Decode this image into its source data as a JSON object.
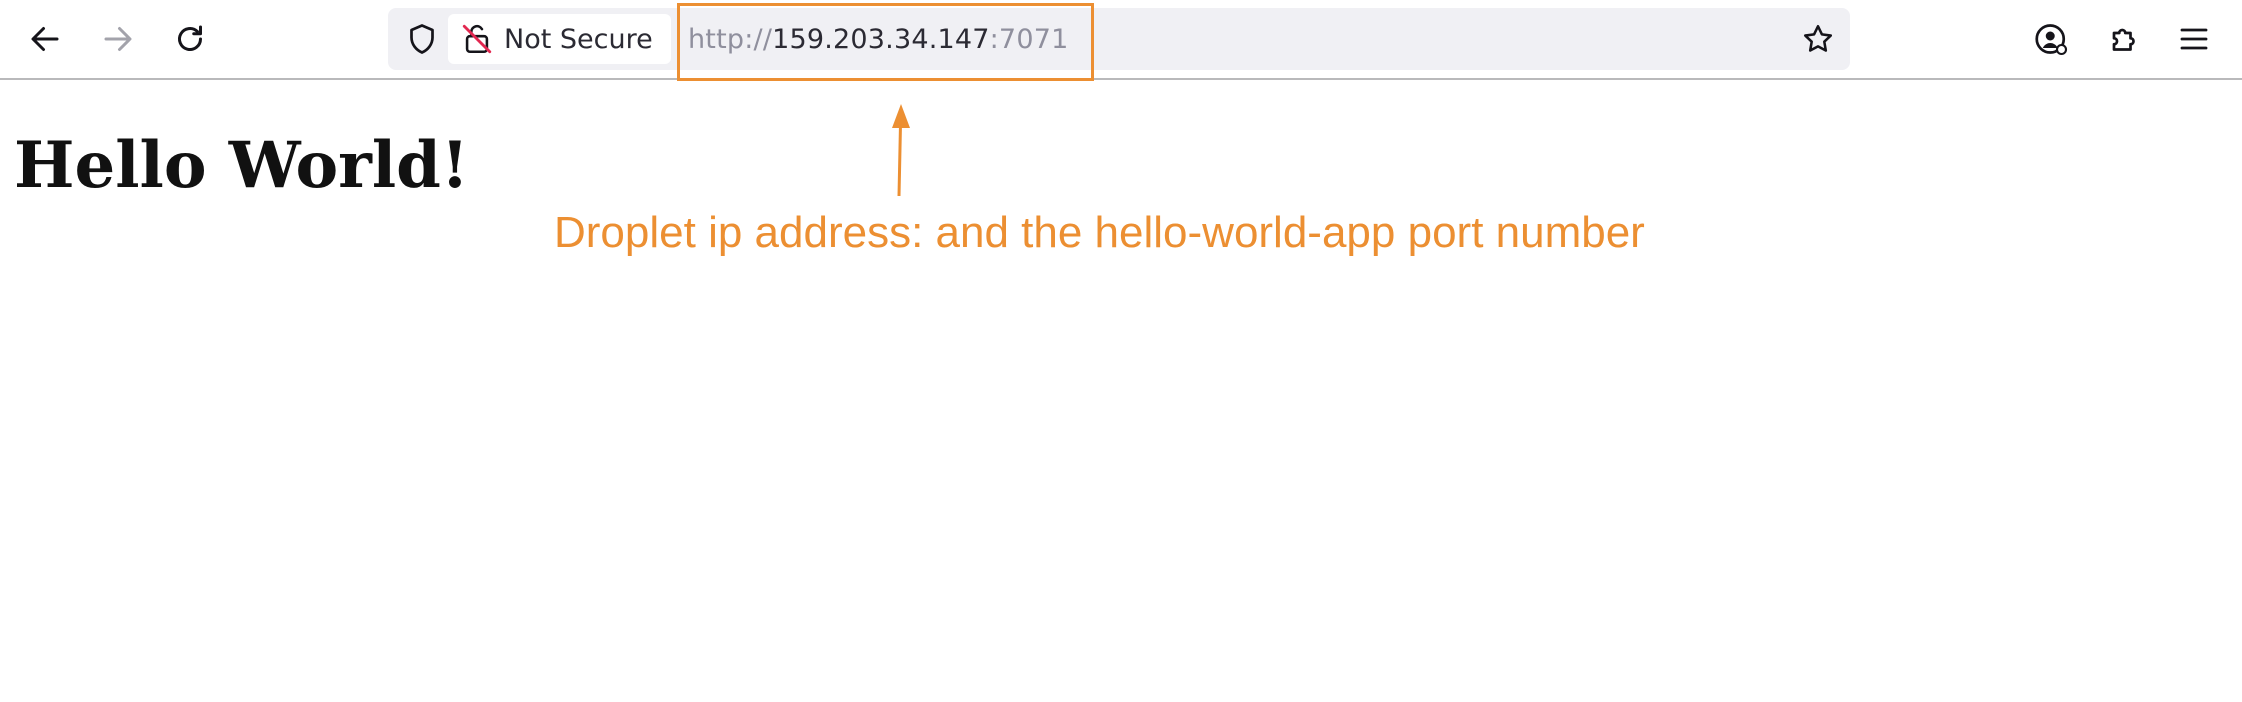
{
  "browser": {
    "security_label": "Not Secure",
    "url": {
      "scheme": "http://",
      "host": "159.203.34.147",
      "port": ":7071"
    },
    "icons": {
      "back": "arrow-left-icon",
      "forward": "arrow-right-icon",
      "reload": "reload-icon",
      "tracking_protection": "shield-icon",
      "insecure": "lock-strikethrough-icon",
      "bookmark": "star-icon",
      "account": "account-icon",
      "extensions": "puzzle-icon",
      "menu": "hamburger-menu-icon"
    }
  },
  "page": {
    "heading": "Hello World!"
  },
  "annotation": {
    "text": "Droplet ip address: and the hello-world-app port number",
    "color": "#ec8f32"
  }
}
